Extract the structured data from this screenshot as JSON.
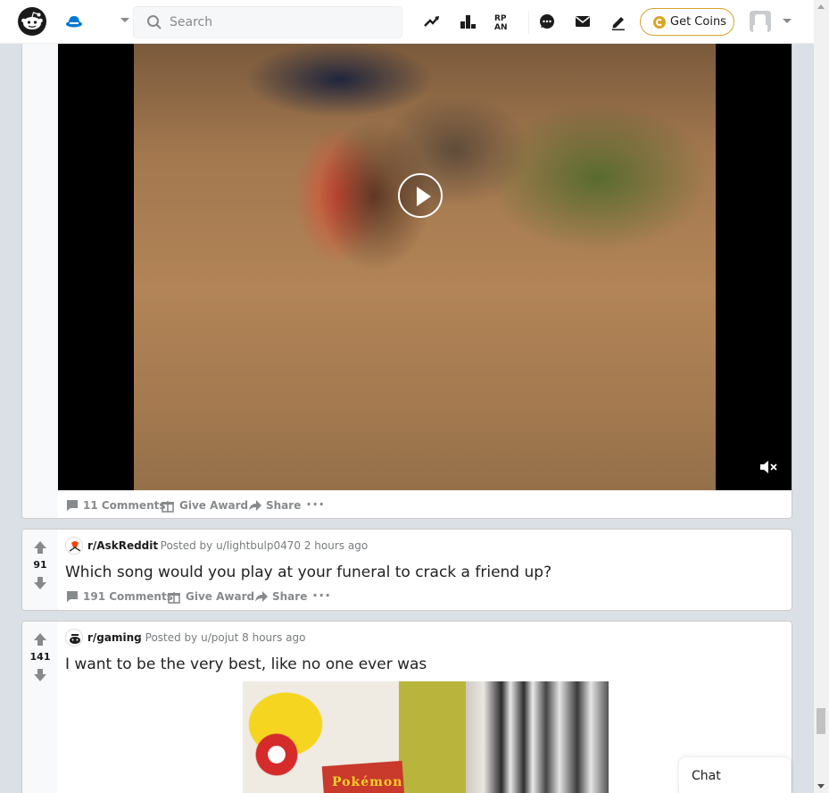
{
  "header": {
    "search_placeholder": "Search",
    "get_coins_label": "Get Coins",
    "icons": [
      "reddit-logo-icon",
      "home-icon",
      "chevron-down-icon",
      "search-icon",
      "trending-icon",
      "leaderboard-icon",
      "rpan-icon",
      "chat-icon",
      "mail-icon",
      "pencil-icon",
      "coin-icon",
      "avatar",
      "chevron-down-icon"
    ]
  },
  "posts": [
    {
      "type": "video",
      "actions": {
        "comments": "11 Comments",
        "award": "Give Award",
        "share": "Share",
        "more": "···"
      }
    },
    {
      "votes": "91",
      "subreddit": "r/AskReddit",
      "posted_by": "· Posted by u/lightbulp0470 2 hours ago",
      "title": "Which song would you play at your funeral to crack a friend up?",
      "actions": {
        "comments": "191 Comments",
        "award": "Give Award",
        "share": "Share",
        "more": "···"
      }
    },
    {
      "votes": "141",
      "subreddit": "r/gaming",
      "posted_by": "· Posted by u/pojut 8 hours ago",
      "title": "I want to be the very best, like no one ever was",
      "image_text": "Pokémon"
    }
  ],
  "chat": {
    "label": "Chat"
  },
  "colors": {
    "accent": "#0079d3",
    "coins_border": "#d7a22a",
    "muted": "#878a8c"
  }
}
